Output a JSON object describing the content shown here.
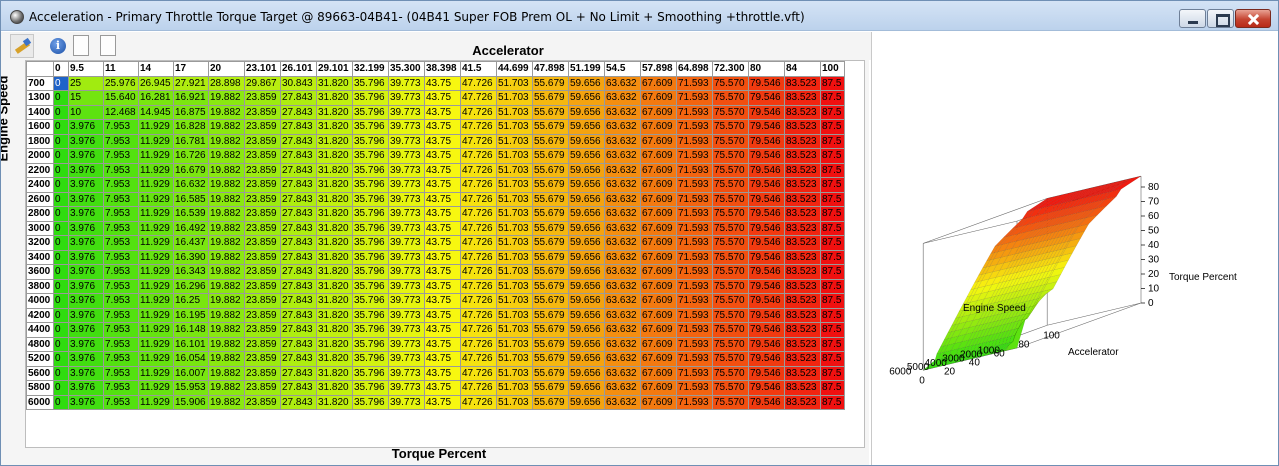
{
  "window": {
    "title": "Acceleration - Primary Throttle Torque Target @ 89663-04B41- (04B41 Super FOB Prem OL + No Limit + Smoothing +throttle.vft)"
  },
  "toolbar": {
    "items": [
      {
        "name": "paint-icon"
      },
      {
        "name": "info-icon",
        "glyph": "i"
      },
      {
        "name": "document-icon"
      },
      {
        "name": "document-icon"
      }
    ]
  },
  "table": {
    "x_axis_label": "Accelerator",
    "y_axis_label": "Engine Speed",
    "value_label": "Torque Percent",
    "selected_cell": {
      "row": 0,
      "col": 0
    },
    "columns": [
      "0",
      "9.5",
      "11",
      "14",
      "17",
      "20",
      "23.101",
      "26.101",
      "29.101",
      "32.199",
      "35.300",
      "38.398",
      "41.5",
      "44.699",
      "47.898",
      "51.199",
      "54.5",
      "57.898",
      "64.898",
      "72.300",
      "80",
      "84",
      "100"
    ],
    "rows": [
      {
        "rpm": "700",
        "values": [
          "0",
          "25",
          "25.976",
          "26.945",
          "27.921",
          "28.898",
          "29.867",
          "30.843",
          "31.820",
          "35.796",
          "39.773",
          "43.75",
          "47.726",
          "51.703",
          "55.679",
          "59.656",
          "63.632",
          "67.609",
          "71.593",
          "75.570",
          "79.546",
          "83.523",
          "87.5"
        ]
      },
      {
        "rpm": "1300",
        "values": [
          "0",
          "15",
          "15.640",
          "16.281",
          "16.921",
          "19.882",
          "23.859",
          "27.843",
          "31.820",
          "35.796",
          "39.773",
          "43.75",
          "47.726",
          "51.703",
          "55.679",
          "59.656",
          "63.632",
          "67.609",
          "71.593",
          "75.570",
          "79.546",
          "83.523",
          "87.5"
        ]
      },
      {
        "rpm": "1400",
        "values": [
          "0",
          "10",
          "12.468",
          "14.945",
          "16.875",
          "19.882",
          "23.859",
          "27.843",
          "31.820",
          "35.796",
          "39.773",
          "43.75",
          "47.726",
          "51.703",
          "55.679",
          "59.656",
          "63.632",
          "67.609",
          "71.593",
          "75.570",
          "79.546",
          "83.523",
          "87.5"
        ]
      },
      {
        "rpm": "1600",
        "values": [
          "0",
          "3.976",
          "7.953",
          "11.929",
          "16.828",
          "19.882",
          "23.859",
          "27.843",
          "31.820",
          "35.796",
          "39.773",
          "43.75",
          "47.726",
          "51.703",
          "55.679",
          "59.656",
          "63.632",
          "67.609",
          "71.593",
          "75.570",
          "79.546",
          "83.523",
          "87.5"
        ]
      },
      {
        "rpm": "1800",
        "values": [
          "0",
          "3.976",
          "7.953",
          "11.929",
          "16.781",
          "19.882",
          "23.859",
          "27.843",
          "31.820",
          "35.796",
          "39.773",
          "43.75",
          "47.726",
          "51.703",
          "55.679",
          "59.656",
          "63.632",
          "67.609",
          "71.593",
          "75.570",
          "79.546",
          "83.523",
          "87.5"
        ]
      },
      {
        "rpm": "2000",
        "values": [
          "0",
          "3.976",
          "7.953",
          "11.929",
          "16.726",
          "19.882",
          "23.859",
          "27.843",
          "31.820",
          "35.796",
          "39.773",
          "43.75",
          "47.726",
          "51.703",
          "55.679",
          "59.656",
          "63.632",
          "67.609",
          "71.593",
          "75.570",
          "79.546",
          "83.523",
          "87.5"
        ]
      },
      {
        "rpm": "2200",
        "values": [
          "0",
          "3.976",
          "7.953",
          "11.929",
          "16.679",
          "19.882",
          "23.859",
          "27.843",
          "31.820",
          "35.796",
          "39.773",
          "43.75",
          "47.726",
          "51.703",
          "55.679",
          "59.656",
          "63.632",
          "67.609",
          "71.593",
          "75.570",
          "79.546",
          "83.523",
          "87.5"
        ]
      },
      {
        "rpm": "2400",
        "values": [
          "0",
          "3.976",
          "7.953",
          "11.929",
          "16.632",
          "19.882",
          "23.859",
          "27.843",
          "31.820",
          "35.796",
          "39.773",
          "43.75",
          "47.726",
          "51.703",
          "55.679",
          "59.656",
          "63.632",
          "67.609",
          "71.593",
          "75.570",
          "79.546",
          "83.523",
          "87.5"
        ]
      },
      {
        "rpm": "2600",
        "values": [
          "0",
          "3.976",
          "7.953",
          "11.929",
          "16.585",
          "19.882",
          "23.859",
          "27.843",
          "31.820",
          "35.796",
          "39.773",
          "43.75",
          "47.726",
          "51.703",
          "55.679",
          "59.656",
          "63.632",
          "67.609",
          "71.593",
          "75.570",
          "79.546",
          "83.523",
          "87.5"
        ]
      },
      {
        "rpm": "2800",
        "values": [
          "0",
          "3.976",
          "7.953",
          "11.929",
          "16.539",
          "19.882",
          "23.859",
          "27.843",
          "31.820",
          "35.796",
          "39.773",
          "43.75",
          "47.726",
          "51.703",
          "55.679",
          "59.656",
          "63.632",
          "67.609",
          "71.593",
          "75.570",
          "79.546",
          "83.523",
          "87.5"
        ]
      },
      {
        "rpm": "3000",
        "values": [
          "0",
          "3.976",
          "7.953",
          "11.929",
          "16.492",
          "19.882",
          "23.859",
          "27.843",
          "31.820",
          "35.796",
          "39.773",
          "43.75",
          "47.726",
          "51.703",
          "55.679",
          "59.656",
          "63.632",
          "67.609",
          "71.593",
          "75.570",
          "79.546",
          "83.523",
          "87.5"
        ]
      },
      {
        "rpm": "3200",
        "values": [
          "0",
          "3.976",
          "7.953",
          "11.929",
          "16.437",
          "19.882",
          "23.859",
          "27.843",
          "31.820",
          "35.796",
          "39.773",
          "43.75",
          "47.726",
          "51.703",
          "55.679",
          "59.656",
          "63.632",
          "67.609",
          "71.593",
          "75.570",
          "79.546",
          "83.523",
          "87.5"
        ]
      },
      {
        "rpm": "3400",
        "values": [
          "0",
          "3.976",
          "7.953",
          "11.929",
          "16.390",
          "19.882",
          "23.859",
          "27.843",
          "31.820",
          "35.796",
          "39.773",
          "43.75",
          "47.726",
          "51.703",
          "55.679",
          "59.656",
          "63.632",
          "67.609",
          "71.593",
          "75.570",
          "79.546",
          "83.523",
          "87.5"
        ]
      },
      {
        "rpm": "3600",
        "values": [
          "0",
          "3.976",
          "7.953",
          "11.929",
          "16.343",
          "19.882",
          "23.859",
          "27.843",
          "31.820",
          "35.796",
          "39.773",
          "43.75",
          "47.726",
          "51.703",
          "55.679",
          "59.656",
          "63.632",
          "67.609",
          "71.593",
          "75.570",
          "79.546",
          "83.523",
          "87.5"
        ]
      },
      {
        "rpm": "3800",
        "values": [
          "0",
          "3.976",
          "7.953",
          "11.929",
          "16.296",
          "19.882",
          "23.859",
          "27.843",
          "31.820",
          "35.796",
          "39.773",
          "43.75",
          "47.726",
          "51.703",
          "55.679",
          "59.656",
          "63.632",
          "67.609",
          "71.593",
          "75.570",
          "79.546",
          "83.523",
          "87.5"
        ]
      },
      {
        "rpm": "4000",
        "values": [
          "0",
          "3.976",
          "7.953",
          "11.929",
          "16.25",
          "19.882",
          "23.859",
          "27.843",
          "31.820",
          "35.796",
          "39.773",
          "43.75",
          "47.726",
          "51.703",
          "55.679",
          "59.656",
          "63.632",
          "67.609",
          "71.593",
          "75.570",
          "79.546",
          "83.523",
          "87.5"
        ]
      },
      {
        "rpm": "4200",
        "values": [
          "0",
          "3.976",
          "7.953",
          "11.929",
          "16.195",
          "19.882",
          "23.859",
          "27.843",
          "31.820",
          "35.796",
          "39.773",
          "43.75",
          "47.726",
          "51.703",
          "55.679",
          "59.656",
          "63.632",
          "67.609",
          "71.593",
          "75.570",
          "79.546",
          "83.523",
          "87.5"
        ]
      },
      {
        "rpm": "4400",
        "values": [
          "0",
          "3.976",
          "7.953",
          "11.929",
          "16.148",
          "19.882",
          "23.859",
          "27.843",
          "31.820",
          "35.796",
          "39.773",
          "43.75",
          "47.726",
          "51.703",
          "55.679",
          "59.656",
          "63.632",
          "67.609",
          "71.593",
          "75.570",
          "79.546",
          "83.523",
          "87.5"
        ]
      },
      {
        "rpm": "4800",
        "values": [
          "0",
          "3.976",
          "7.953",
          "11.929",
          "16.101",
          "19.882",
          "23.859",
          "27.843",
          "31.820",
          "35.796",
          "39.773",
          "43.75",
          "47.726",
          "51.703",
          "55.679",
          "59.656",
          "63.632",
          "67.609",
          "71.593",
          "75.570",
          "79.546",
          "83.523",
          "87.5"
        ]
      },
      {
        "rpm": "5200",
        "values": [
          "0",
          "3.976",
          "7.953",
          "11.929",
          "16.054",
          "19.882",
          "23.859",
          "27.843",
          "31.820",
          "35.796",
          "39.773",
          "43.75",
          "47.726",
          "51.703",
          "55.679",
          "59.656",
          "63.632",
          "67.609",
          "71.593",
          "75.570",
          "79.546",
          "83.523",
          "87.5"
        ]
      },
      {
        "rpm": "5600",
        "values": [
          "0",
          "3.976",
          "7.953",
          "11.929",
          "16.007",
          "19.882",
          "23.859",
          "27.843",
          "31.820",
          "35.796",
          "39.773",
          "43.75",
          "47.726",
          "51.703",
          "55.679",
          "59.656",
          "63.632",
          "67.609",
          "71.593",
          "75.570",
          "79.546",
          "83.523",
          "87.5"
        ]
      },
      {
        "rpm": "5800",
        "values": [
          "0",
          "3.976",
          "7.953",
          "11.929",
          "15.953",
          "19.882",
          "23.859",
          "27.843",
          "31.820",
          "35.796",
          "39.773",
          "43.75",
          "47.726",
          "51.703",
          "55.679",
          "59.656",
          "63.632",
          "67.609",
          "71.593",
          "75.570",
          "79.546",
          "83.523",
          "87.5"
        ]
      },
      {
        "rpm": "6000",
        "values": [
          "0",
          "3.976",
          "7.953",
          "11.929",
          "15.906",
          "19.882",
          "23.859",
          "27.843",
          "31.820",
          "35.796",
          "39.773",
          "43.75",
          "47.726",
          "51.703",
          "55.679",
          "59.656",
          "63.632",
          "67.609",
          "71.593",
          "75.570",
          "79.546",
          "83.523",
          "87.5"
        ]
      }
    ]
  },
  "colors": {
    "low": "#2fdc10",
    "mid": "#f7f710",
    "high": "#f01010",
    "selected": "#1f63c8"
  },
  "surface_plot": {
    "x_label": "Accelerator",
    "y_label": "Engine Speed",
    "z_label": "Torque Percent",
    "x_ticks": [
      "0",
      "20",
      "40",
      "60",
      "80",
      "100"
    ],
    "y_ticks": [
      "1000",
      "2000",
      "3000",
      "4000",
      "5000",
      "6000"
    ],
    "z_ticks": [
      "0",
      "10",
      "20",
      "30",
      "40",
      "50",
      "60",
      "70",
      "80"
    ]
  }
}
